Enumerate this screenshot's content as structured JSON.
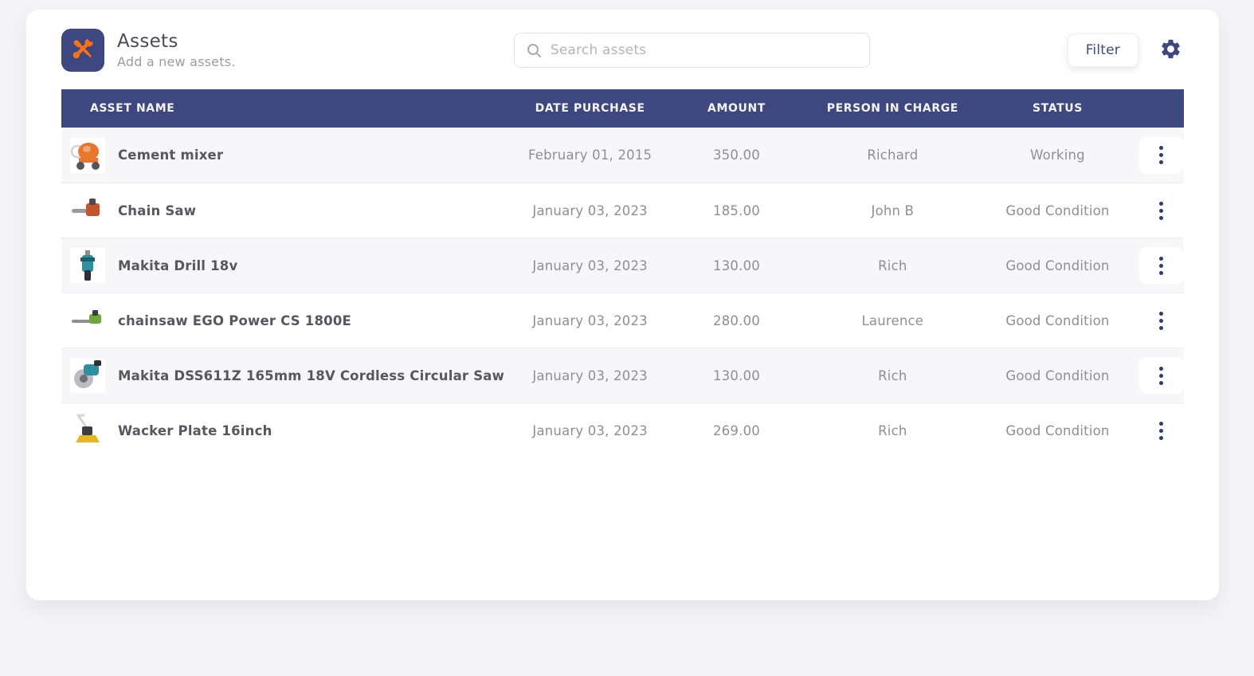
{
  "page": {
    "background": "#f4f4f6",
    "card_background": "#ffffff"
  },
  "header": {
    "title": "Assets",
    "subtitle": "Add a new assets.",
    "app_icon": "crossed-tools-icon",
    "app_icon_bg": "#3f4780",
    "app_icon_color": "#f97316",
    "search": {
      "placeholder": "Search assets",
      "value": ""
    },
    "filter_label": "Filter",
    "gear_icon_color": "#3f4780"
  },
  "table": {
    "header_bg": "#3f4780",
    "header_text_color": "#f4f5fa",
    "stripe_color": "#f7f7fa",
    "columns": [
      "ASSET NAME",
      "DATE PURCHASE",
      "AMOUNT",
      "PERSON IN CHARGE",
      "STATUS"
    ],
    "rows": [
      {
        "name": "Cement mixer",
        "date": "February 01, 2015",
        "amount": "350.00",
        "person": "Richard",
        "status": "Working",
        "image": "cement-mixer",
        "image_color": "#e8772e"
      },
      {
        "name": "Chain Saw",
        "date": "January 03, 2023",
        "amount": "185.00",
        "person": "John B",
        "status": "Good Condition",
        "image": "chain-saw",
        "image_color": "#c2552b"
      },
      {
        "name": "Makita Drill 18v",
        "date": "January 03, 2023",
        "amount": "130.00",
        "person": "Rich",
        "status": "Good Condition",
        "image": "drill",
        "image_color": "#2e8f9e"
      },
      {
        "name": "chainsaw EGO Power CS 1800E",
        "date": "January 03, 2023",
        "amount": "280.00",
        "person": "Laurence",
        "status": "Good Condition",
        "image": "green-chainsaw",
        "image_color": "#74a43c"
      },
      {
        "name": "Makita DSS611Z 165mm 18V Cordless Circular Saw",
        "date": "January 03, 2023",
        "amount": "130.00",
        "person": "Rich",
        "status": "Good Condition",
        "image": "circular-saw",
        "image_color": "#2e8f9e"
      },
      {
        "name": "Wacker Plate 16inch",
        "date": "January 03, 2023",
        "amount": "269.00",
        "person": "Rich",
        "status": "Good Condition",
        "image": "wacker-plate",
        "image_color": "#e5b61f"
      }
    ]
  }
}
